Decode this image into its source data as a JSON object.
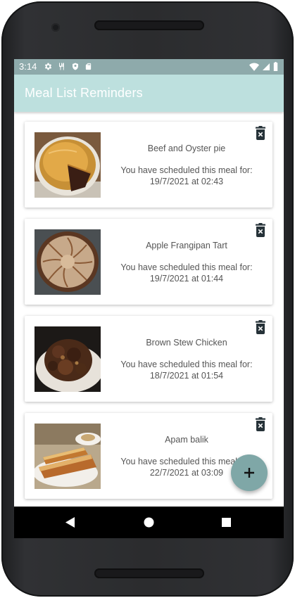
{
  "status_bar": {
    "time": "3:14",
    "left_icons": [
      "gear-icon",
      "restaurant-icon",
      "shield-icon",
      "sd-card-icon"
    ],
    "right_icons": [
      "wifi-icon",
      "signal-icon",
      "battery-icon"
    ]
  },
  "app_bar": {
    "title": "Meal List Reminders",
    "color": "#bde0de"
  },
  "meals": [
    {
      "name": "Beef and Oyster pie",
      "schedule_label": "You have scheduled this meal for:",
      "schedule_time": "19/7/2021 at 02:43",
      "image": "pie-photo"
    },
    {
      "name": "Apple Frangipan Tart",
      "schedule_label": "You have scheduled this meal for:",
      "schedule_time": "19/7/2021 at 01:44",
      "image": "tart-photo"
    },
    {
      "name": "Brown Stew Chicken",
      "schedule_label": "You have scheduled this meal for:",
      "schedule_time": "18/7/2021 at 01:54",
      "image": "stew-photo"
    },
    {
      "name": "Apam balik",
      "schedule_label": "You have scheduled this meal for:",
      "schedule_time": "22/7/2021 at 03:09",
      "image": "pancake-photo"
    }
  ],
  "fab": {
    "icon": "plus-icon",
    "color": "#7fa7a7"
  },
  "nav": {
    "icons": [
      "back-icon",
      "home-icon",
      "recents-icon"
    ]
  }
}
